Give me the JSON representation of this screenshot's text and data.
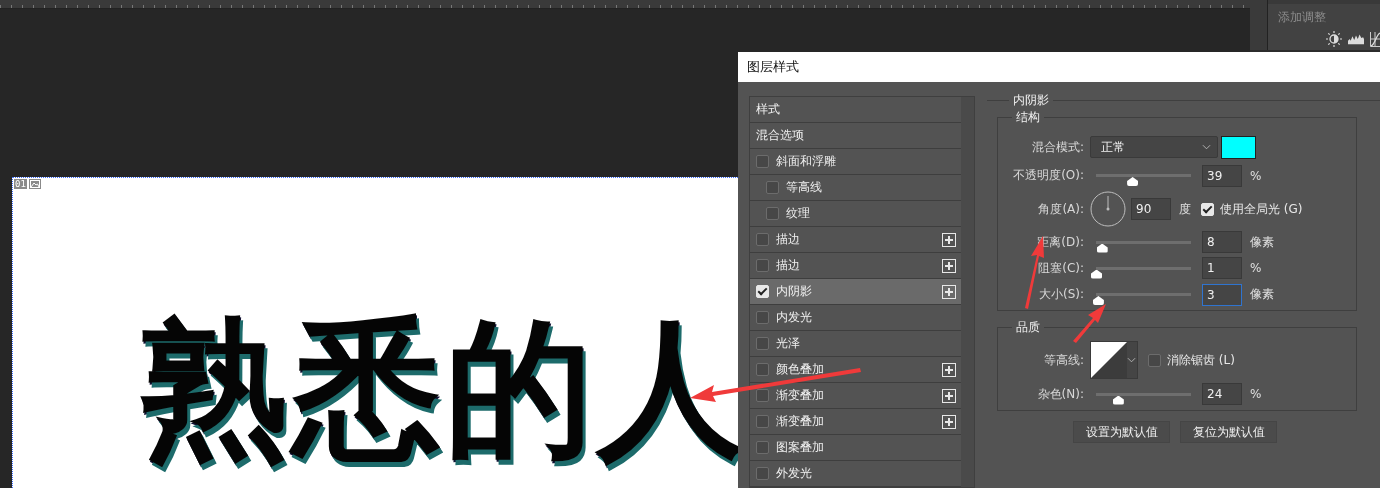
{
  "adjustments_panel": {
    "title": "添加调整"
  },
  "document": {
    "layer_number": "01",
    "text": "熟悉的人"
  },
  "dialog": {
    "title": "图层样式",
    "style_list": [
      {
        "label": "样式",
        "kind": "header",
        "selected": false
      },
      {
        "label": "混合选项",
        "kind": "header",
        "selected": false
      },
      {
        "label": "斜面和浮雕",
        "kind": "effect",
        "checked": false,
        "add_button": false,
        "selected": false,
        "children": [
          {
            "label": "等高线",
            "kind": "effect",
            "checked": false,
            "add_button": false,
            "selected": false
          },
          {
            "label": "纹理",
            "kind": "effect",
            "checked": false,
            "add_button": false,
            "selected": false
          }
        ]
      },
      {
        "label": "描边",
        "kind": "effect",
        "checked": false,
        "add_button": true,
        "selected": false
      },
      {
        "label": "描边",
        "kind": "effect",
        "checked": false,
        "add_button": true,
        "selected": false
      },
      {
        "label": "内阴影",
        "kind": "effect",
        "checked": true,
        "add_button": true,
        "selected": true
      },
      {
        "label": "内发光",
        "kind": "effect",
        "checked": false,
        "add_button": false,
        "selected": false
      },
      {
        "label": "光泽",
        "kind": "effect",
        "checked": false,
        "add_button": false,
        "selected": false
      },
      {
        "label": "颜色叠加",
        "kind": "effect",
        "checked": false,
        "add_button": true,
        "selected": false
      },
      {
        "label": "渐变叠加",
        "kind": "effect",
        "checked": false,
        "add_button": true,
        "selected": false
      },
      {
        "label": "渐变叠加",
        "kind": "effect",
        "checked": false,
        "add_button": true,
        "selected": false
      },
      {
        "label": "图案叠加",
        "kind": "effect",
        "checked": false,
        "add_button": false,
        "selected": false
      },
      {
        "label": "外发光",
        "kind": "effect",
        "checked": false,
        "add_button": false,
        "selected": false
      }
    ],
    "section_title": "内阴影",
    "structure": {
      "title": "结构",
      "blend_mode": {
        "label": "混合模式:",
        "value": "正常",
        "color": "#00ffff"
      },
      "opacity": {
        "label": "不透明度(O):",
        "level": 0.38,
        "value": "39",
        "unit": "%"
      },
      "angle": {
        "label": "角度(A):",
        "value": "90",
        "unit": "度",
        "global_light": {
          "label": "使用全局光 (G)",
          "checked": true
        }
      },
      "distance": {
        "label": "距离(D):",
        "level": 0.06,
        "value": "8",
        "unit": "像素"
      },
      "choke": {
        "label": "阻塞(C):",
        "level": 0.0,
        "value": "1",
        "unit": "%"
      },
      "size": {
        "label": "大小(S):",
        "level": 0.02,
        "value": "3",
        "unit": "像素",
        "focused": true
      }
    },
    "quality": {
      "title": "品质",
      "contour": {
        "label": "等高线:",
        "anti_alias": {
          "label": "消除锯齿 (L)",
          "checked": false
        }
      },
      "noise": {
        "label": "杂色(N):",
        "level": 0.23,
        "value": "24",
        "unit": "%"
      }
    },
    "buttons": [
      "设置为默认值",
      "复位为默认值"
    ]
  }
}
